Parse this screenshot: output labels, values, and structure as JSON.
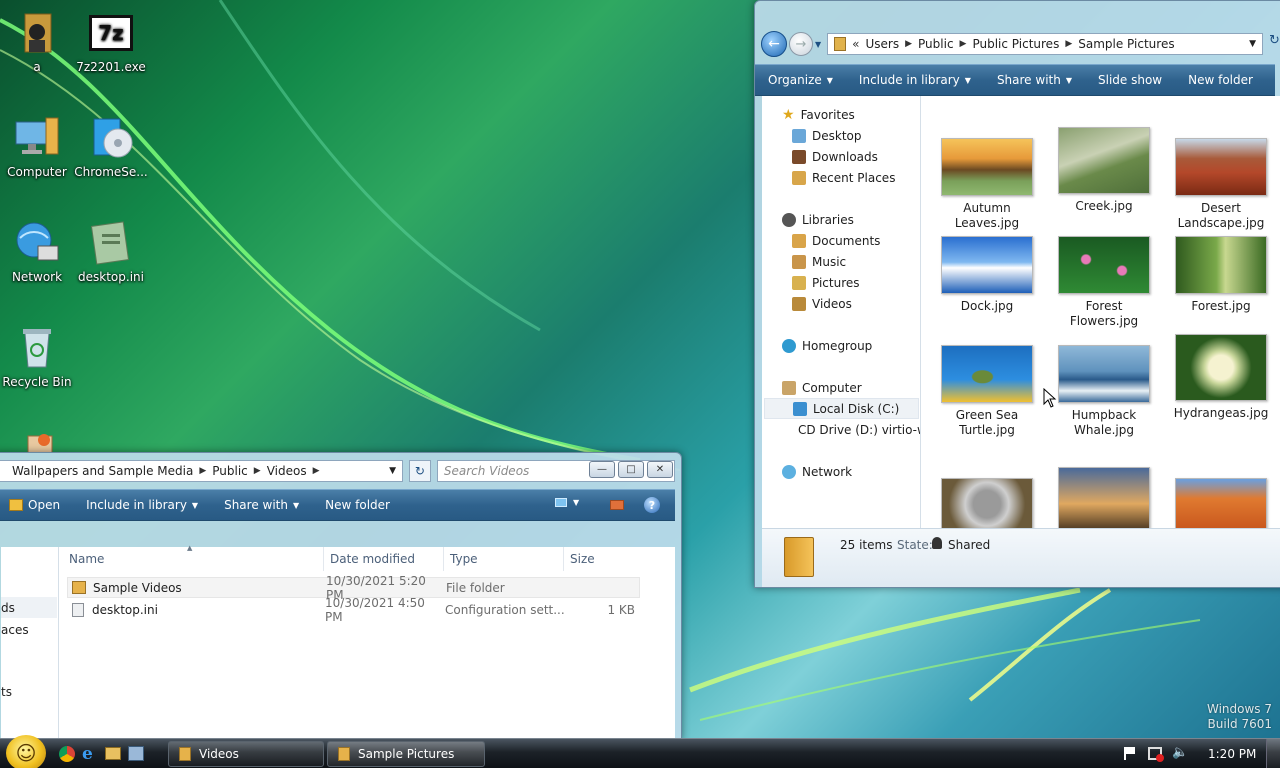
{
  "desktop": {
    "icons": [
      {
        "label": "a",
        "icon": "user-folder-icon"
      },
      {
        "label": "7z2201.exe",
        "icon": "7zip-icon",
        "badge": "7z"
      },
      {
        "label": "Computer",
        "icon": "computer-icon"
      },
      {
        "label": "ChromeSe...",
        "icon": "setup-disc-icon"
      },
      {
        "label": "Network",
        "icon": "network-icon"
      },
      {
        "label": "desktop.ini",
        "icon": "ini-file-icon"
      },
      {
        "label": "Recycle Bin",
        "icon": "recycle-bin-icon"
      }
    ],
    "watermark": {
      "line1": "Windows 7",
      "line2": "Build 7601"
    }
  },
  "pictures_window": {
    "breadcrumb": [
      "Users",
      "Public",
      "Public Pictures",
      "Sample Pictures"
    ],
    "toolbar": {
      "organize": "Organize",
      "include": "Include in library",
      "share": "Share with",
      "slideshow": "Slide show",
      "newfolder": "New folder"
    },
    "nav": {
      "favorites": "Favorites",
      "desktop": "Desktop",
      "downloads": "Downloads",
      "recent": "Recent Places",
      "libraries": "Libraries",
      "documents": "Documents",
      "music": "Music",
      "pictures": "Pictures",
      "videos": "Videos",
      "homegroup": "Homegroup",
      "computer": "Computer",
      "localdisk": "Local Disk (C:)",
      "cddrive": "CD Drive (D:) virtio-w",
      "network": "Network"
    },
    "thumbs": [
      {
        "l1": "Autumn",
        "l2": "Leaves.jpg"
      },
      {
        "l1": "Creek.jpg",
        "l2": ""
      },
      {
        "l1": "Desert",
        "l2": "Landscape.jpg"
      },
      {
        "l1": "Dock.jpg",
        "l2": ""
      },
      {
        "l1": "Forest",
        "l2": "Flowers.jpg"
      },
      {
        "l1": "Forest.jpg",
        "l2": ""
      },
      {
        "l1": "Green Sea",
        "l2": "Turtle.jpg"
      },
      {
        "l1": "Humpback",
        "l2": "Whale.jpg"
      },
      {
        "l1": "Hydrangeas.jpg",
        "l2": ""
      }
    ],
    "status": {
      "count": "25 items",
      "state_label": "State:",
      "state_value": "Shared"
    }
  },
  "videos_window": {
    "breadcrumb": [
      "Wallpapers and Sample Media",
      "Public",
      "Videos"
    ],
    "search_placeholder": "Search Videos",
    "toolbar": {
      "open": "Open",
      "include": "Include in library",
      "share": "Share with",
      "newfolder": "New folder"
    },
    "columns": {
      "name": "Name",
      "date": "Date modified",
      "type": "Type",
      "size": "Size"
    },
    "rows": [
      {
        "name": "Sample Videos",
        "date": "10/30/2021 5:20 PM",
        "type": "File folder",
        "size": ""
      },
      {
        "name": "desktop.ini",
        "date": "10/30/2021 4:50 PM",
        "type": "Configuration sett...",
        "size": "1 KB"
      }
    ],
    "nav_fragments": [
      "ds",
      "aces",
      "ts"
    ]
  },
  "taskbar": {
    "buttons": [
      "Videos",
      "Sample Pictures"
    ],
    "clock": "1:20 PM"
  }
}
